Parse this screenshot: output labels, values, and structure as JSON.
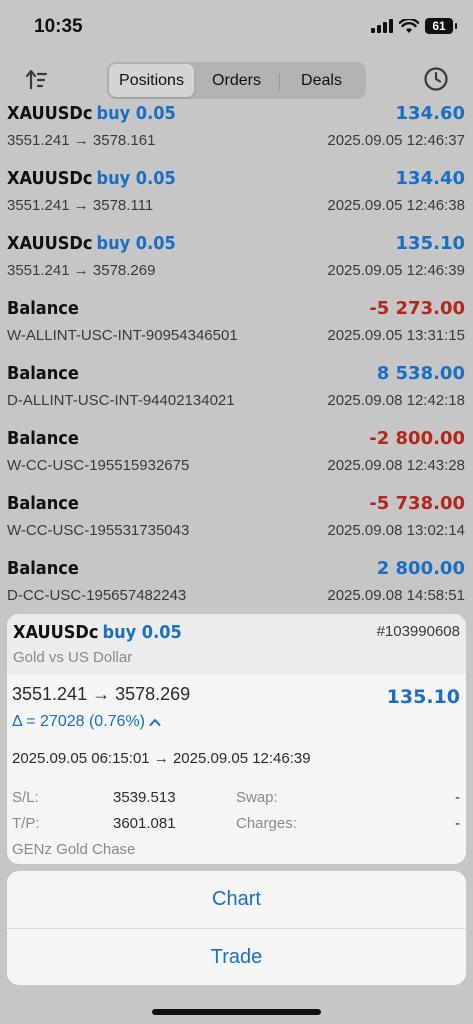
{
  "status_bar": {
    "time": "10:35",
    "battery": "61"
  },
  "toolbar": {
    "tabs": [
      {
        "label": "Positions",
        "active": true
      },
      {
        "label": "Orders",
        "active": false
      },
      {
        "label": "Deals",
        "active": false
      }
    ]
  },
  "rows": [
    {
      "symbol": "XAUUSDc",
      "type": "buy 0.05",
      "value": "134.60",
      "sign": "pos",
      "sub": "3551.241 → 3578.161",
      "date": "2025.09.05 12:46:37"
    },
    {
      "symbol": "XAUUSDc",
      "type": "buy 0.05",
      "value": "134.40",
      "sign": "pos",
      "sub": "3551.241 → 3578.111",
      "date": "2025.09.05 12:46:38"
    },
    {
      "symbol": "XAUUSDc",
      "type": "buy 0.05",
      "value": "135.10",
      "sign": "pos",
      "sub": "3551.241 → 3578.269",
      "date": "2025.09.05 12:46:39"
    },
    {
      "symbol": "Balance",
      "type": "",
      "value": "-5 273.00",
      "sign": "neg",
      "sub": "W-ALLINT-USC-INT-90954346501",
      "date": "2025.09.05 13:31:15"
    },
    {
      "symbol": "Balance",
      "type": "",
      "value": "8 538.00",
      "sign": "pos",
      "sub": "D-ALLINT-USC-INT-94402134021",
      "date": "2025.09.08 12:42:18"
    },
    {
      "symbol": "Balance",
      "type": "",
      "value": "-2 800.00",
      "sign": "neg",
      "sub": "W-CC-USC-195515932675",
      "date": "2025.09.08 12:43:28"
    },
    {
      "symbol": "Balance",
      "type": "",
      "value": "-5 738.00",
      "sign": "neg",
      "sub": "W-CC-USC-195531735043",
      "date": "2025.09.08 13:02:14"
    },
    {
      "symbol": "Balance",
      "type": "",
      "value": "2 800.00",
      "sign": "pos",
      "sub": "D-CC-USC-195657482243",
      "date": "2025.09.08 14:58:51"
    }
  ],
  "detail": {
    "symbol": "XAUUSDc",
    "type": "buy 0.05",
    "ticket": "#103990608",
    "description": "Gold vs US Dollar",
    "prices": "3551.241 → 3578.269",
    "profit": "135.10",
    "delta": "Δ = 27028 (0.76%)",
    "times": "2025.09.05 06:15:01 → 2025.09.05 12:46:39",
    "sl_label": "S/L:",
    "sl_value": "3539.513",
    "tp_label": "T/P:",
    "tp_value": "3601.081",
    "swap_label": "Swap:",
    "swap_value": "-",
    "charges_label": "Charges:",
    "charges_value": "-",
    "strategy": "GENz Gold Chase"
  },
  "actions": {
    "chart": "Chart",
    "trade": "Trade"
  },
  "colors": {
    "accent": "#1a6fc4",
    "negative": "#b4271c"
  },
  "icons": {
    "sort": "sort-icon",
    "history": "clock-icon",
    "expand": "chevron-up-icon"
  }
}
